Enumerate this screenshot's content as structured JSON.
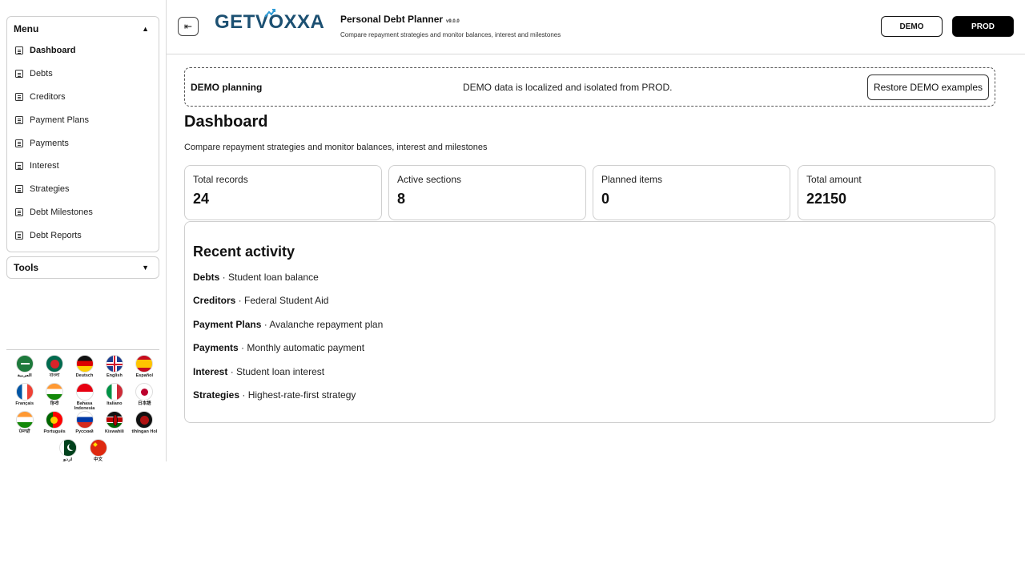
{
  "sidebar": {
    "menu_title": "Menu",
    "items": [
      {
        "label": "Dashboard",
        "active": true
      },
      {
        "label": "Debts"
      },
      {
        "label": "Creditors"
      },
      {
        "label": "Payment Plans"
      },
      {
        "label": "Payments"
      },
      {
        "label": "Interest"
      },
      {
        "label": "Strategies"
      },
      {
        "label": "Debt Milestones"
      },
      {
        "label": "Debt Reports"
      }
    ],
    "tools_title": "Tools",
    "languages": [
      {
        "label": "العربية"
      },
      {
        "label": "বাংলা"
      },
      {
        "label": "Deutsch"
      },
      {
        "label": "English"
      },
      {
        "label": "Español"
      },
      {
        "label": "Français"
      },
      {
        "label": "हिन्दी"
      },
      {
        "label": "Bahasa Indonesia"
      },
      {
        "label": "Italiano"
      },
      {
        "label": "日本語"
      },
      {
        "label": "ਪੰਜਾਬੀ"
      },
      {
        "label": "Português"
      },
      {
        "label": "Русский"
      },
      {
        "label": "Kiswahili"
      },
      {
        "label": "tlhIngan Hol"
      },
      {
        "label": "اردو"
      },
      {
        "label": "中文"
      }
    ]
  },
  "header": {
    "logo_text_1": "GET",
    "logo_text_2": "V",
    "logo_text_3": "OXXA",
    "app_title": "Personal Debt Planner",
    "version": "v9.0.0",
    "subtitle": "Compare repayment strategies and monitor balances, interest and milestones",
    "env_demo": "DEMO",
    "env_prod": "PROD"
  },
  "banner": {
    "title": "DEMO planning",
    "message": "DEMO data is localized and isolated from PROD.",
    "button": "Restore DEMO examples"
  },
  "main": {
    "title": "Dashboard",
    "subtitle": "Compare repayment strategies and monitor balances, interest and milestones",
    "stats": [
      {
        "label": "Total records",
        "value": "24"
      },
      {
        "label": "Active sections",
        "value": "8"
      },
      {
        "label": "Planned items",
        "value": "0"
      },
      {
        "label": "Total amount",
        "value": "22150"
      }
    ],
    "activity_title": "Recent activity",
    "activity": [
      {
        "section": "Debts",
        "text": " · Student loan balance"
      },
      {
        "section": "Creditors",
        "text": " · Federal Student Aid"
      },
      {
        "section": "Payment Plans",
        "text": " · Avalanche repayment plan"
      },
      {
        "section": "Payments",
        "text": " · Monthly automatic payment"
      },
      {
        "section": "Interest",
        "text": " · Student loan interest"
      },
      {
        "section": "Strategies",
        "text": " · Highest-rate-first strategy"
      }
    ]
  }
}
